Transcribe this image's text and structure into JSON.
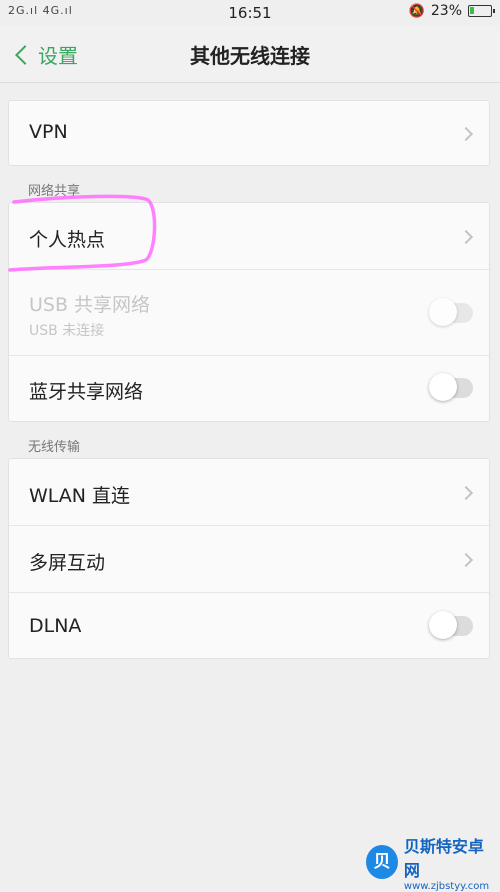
{
  "status_bar": {
    "signal": "2G.ıl  4G.ıl",
    "time": "16:51",
    "battery": "23%",
    "battery_level": 0.23,
    "alarm_icon": "bell-off-icon"
  },
  "nav": {
    "back_label": "设置",
    "title": "其他无线连接"
  },
  "vpn": {
    "label": "VPN"
  },
  "network_share": {
    "header": "网络共享",
    "hotspot": {
      "label": "个人热点"
    },
    "usb": {
      "label": "USB 共享网络",
      "sub": "USB 未连接",
      "enabled": false
    },
    "bluetooth": {
      "label": "蓝牙共享网络",
      "enabled": false
    }
  },
  "wireless": {
    "header": "无线传输",
    "wlan": {
      "label": "WLAN 直连"
    },
    "multiscreen": {
      "label": "多屏互动"
    },
    "dlna": {
      "label": "DLNA",
      "enabled": false
    }
  },
  "watermark": {
    "logo": "贝",
    "title": "贝斯特安卓网",
    "url": "www.zjbstyy.com"
  },
  "colors": {
    "accent": "#3aa660",
    "background": "#efefef",
    "highlight": "#ff6bff"
  }
}
